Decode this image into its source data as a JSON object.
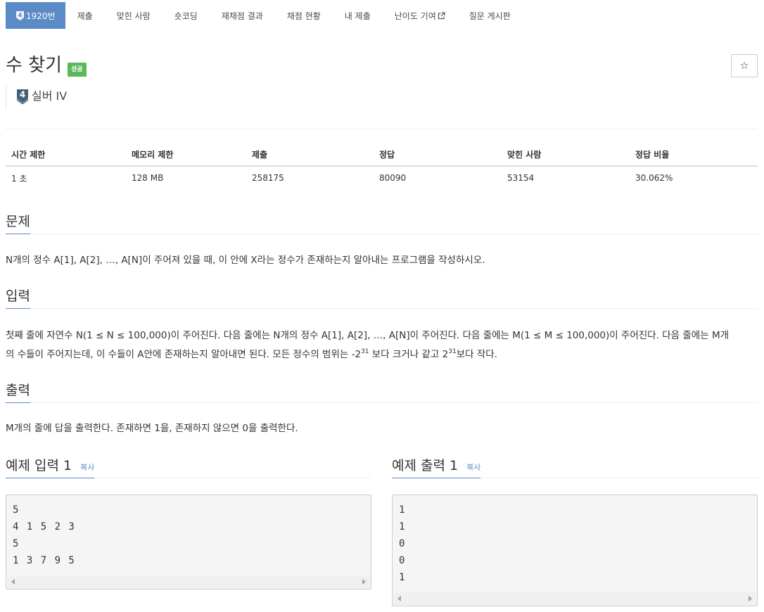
{
  "tabs": [
    {
      "label": "1920번",
      "active": true,
      "tier": "4"
    },
    {
      "label": "제출"
    },
    {
      "label": "맞힌 사람"
    },
    {
      "label": "숏코딩"
    },
    {
      "label": "재채점 결과"
    },
    {
      "label": "채점 현황"
    },
    {
      "label": "내 제출"
    },
    {
      "label": "난이도 기여",
      "icon": "external-link-icon"
    },
    {
      "label": "질문 게시판"
    }
  ],
  "problem": {
    "title": "수 찾기",
    "result_label": "성공",
    "star_icon": "☆",
    "tier_number": "4",
    "tier_name": "실버 IV"
  },
  "info_table": {
    "headers": [
      "시간 제한",
      "메모리 제한",
      "제출",
      "정답",
      "맞힌 사람",
      "정답 비율"
    ],
    "values": [
      "1 초",
      "128 MB",
      "258175",
      "80090",
      "53154",
      "30.062%"
    ]
  },
  "sections": {
    "description": {
      "heading": "문제",
      "text": "N개의 정수 A[1], A[2], …, A[N]이 주어져 있을 때, 이 안에 X라는 정수가 존재하는지 알아내는 프로그램을 작성하시오."
    },
    "input": {
      "heading": "입력",
      "line1": "첫째 줄에 자연수 N(1 ≤ N ≤ 100,000)이 주어진다. 다음 줄에는 N개의 정수 A[1], A[2], …, A[N]이 주어진다. 다음 줄에는 M(1 ≤ M ≤ 100,000)이 주어진다. 다음 줄에는 M개",
      "line2_a": "의 수들이 주어지는데, 이 수들이 A안에 존재하는지 알아내면 된다. 모든 정수의 범위는 -2",
      "line2_sup1": "31",
      "line2_b": " 보다 크거나 같고 2",
      "line2_sup2": "31",
      "line2_c": "보다 작다."
    },
    "output": {
      "heading": "출력",
      "text": "M개의 줄에 답을 출력한다. 존재하면 1을, 존재하지 않으면 0을 출력한다."
    }
  },
  "samples": {
    "input": {
      "heading": "예제 입력 1",
      "copy_label": "복사",
      "content": "5\n4 1 5 2 3\n5\n1 3 7 9 5"
    },
    "output": {
      "heading": "예제 출력 1",
      "copy_label": "복사",
      "content": "1\n1\n0\n0\n1"
    }
  },
  "colors": {
    "accent": "#5b8bc6",
    "success": "#5cb85c",
    "tier_silver": "#435f7a"
  }
}
